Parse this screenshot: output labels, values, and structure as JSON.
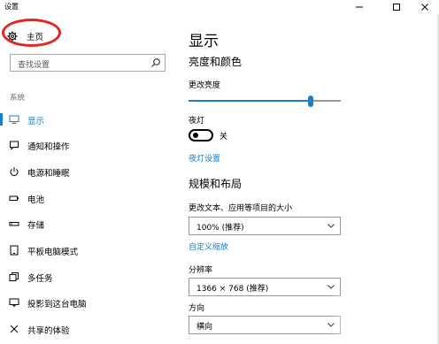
{
  "window": {
    "title": "设置",
    "controls": {
      "minimize": "minimize-icon",
      "maximize": "maximize-icon",
      "close": "close-icon"
    }
  },
  "sidebar": {
    "home_label": "主页",
    "search_placeholder": "查找设置",
    "section_label": "系统",
    "items": [
      {
        "label": "显示",
        "icon": "monitor-icon",
        "active": true
      },
      {
        "label": "通知和操作",
        "icon": "notification-icon",
        "active": false
      },
      {
        "label": "电源和睡眠",
        "icon": "power-icon",
        "active": false
      },
      {
        "label": "电池",
        "icon": "battery-icon",
        "active": false
      },
      {
        "label": "存储",
        "icon": "storage-icon",
        "active": false
      },
      {
        "label": "平板电脑模式",
        "icon": "tablet-icon",
        "active": false
      },
      {
        "label": "多任务",
        "icon": "multitask-icon",
        "active": false
      },
      {
        "label": "投影到这台电脑",
        "icon": "project-icon",
        "active": false
      },
      {
        "label": "共享的体验",
        "icon": "share-icon",
        "active": false
      }
    ]
  },
  "main": {
    "title": "显示",
    "brightness_heading": "亮度和颜色",
    "brightness_label": "更改亮度",
    "brightness_value": 0.8,
    "night_light_label": "夜灯",
    "night_light_state": "关",
    "night_light_settings_link": "夜灯设置",
    "scale_heading": "规模和布局",
    "scale_label": "更改文本、应用等项目的大小",
    "scale_value": "100% (推荐)",
    "custom_scale_link": "自定义缩放",
    "resolution_label": "分辨率",
    "resolution_value": "1366 × 768 (推荐)",
    "orientation_label": "方向",
    "orientation_value": "横向"
  },
  "colors": {
    "accent": "#1a7fc6",
    "annotation": "#e3271f"
  }
}
